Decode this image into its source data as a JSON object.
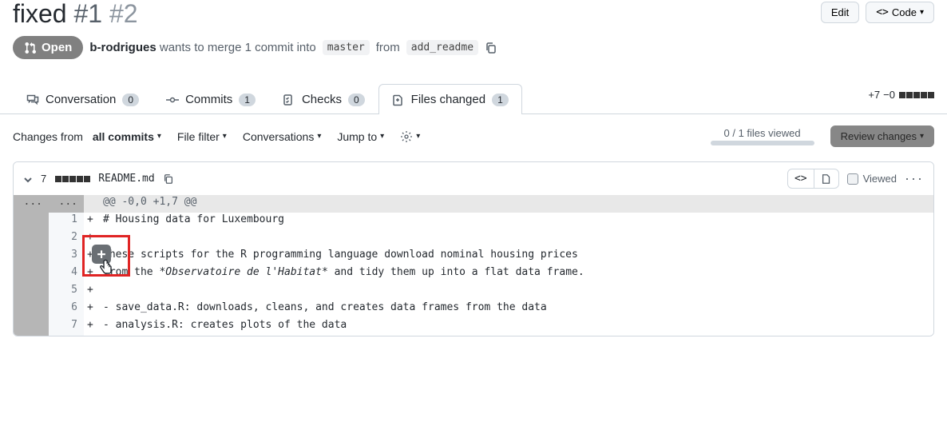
{
  "header": {
    "title_prefix": "fixed",
    "issue_primary": "#1",
    "issue_secondary": "#2",
    "edit_label": "Edit",
    "code_label": "Code"
  },
  "state": {
    "status": "Open",
    "author": "b-rodrigues",
    "action_text": "wants to merge 1 commit into",
    "base_branch": "master",
    "from_label": "from",
    "compare_branch": "add_readme"
  },
  "tabs": {
    "conversation": {
      "label": "Conversation",
      "count": "0"
    },
    "commits": {
      "label": "Commits",
      "count": "1"
    },
    "checks": {
      "label": "Checks",
      "count": "0"
    },
    "files": {
      "label": "Files changed",
      "count": "1"
    }
  },
  "diffstat": {
    "additions": "+7",
    "deletions": "−0"
  },
  "toolbar": {
    "changes_prefix": "Changes from",
    "changes_scope": "all commits",
    "file_filter": "File filter",
    "conversations": "Conversations",
    "jump_to": "Jump to",
    "files_viewed": "0 / 1 files viewed",
    "review": "Review changes"
  },
  "file": {
    "change_count": "7",
    "name": "README.md",
    "viewed_label": "Viewed"
  },
  "diff": {
    "hunk": "@@ -0,0 +1,7 @@",
    "lines": [
      {
        "n": "1",
        "m": "+",
        "t": "# Housing data for Luxembourg"
      },
      {
        "n": "2",
        "m": "+",
        "t": ""
      },
      {
        "n": "3",
        "m": "+",
        "t": "These scripts for the R programming language download nominal housing prices"
      },
      {
        "n": "4",
        "m": "+",
        "t_pre": "from the ",
        "t_em": "*Observatoire de l'Habitat*",
        "t_post": " and tidy them up into a flat data frame."
      },
      {
        "n": "5",
        "m": "+",
        "t": ""
      },
      {
        "n": "6",
        "m": "+",
        "t": "- save_data.R: downloads, cleans, and creates data frames from the data"
      },
      {
        "n": "7",
        "m": "+",
        "t": "- analysis.R: creates plots of the data"
      }
    ]
  }
}
